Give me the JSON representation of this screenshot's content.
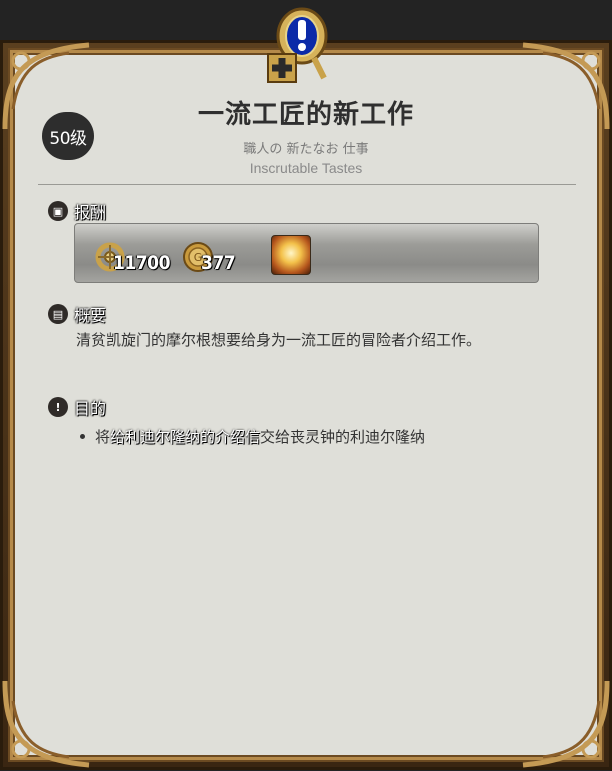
{
  "quest": {
    "level": "50级",
    "title": "一流工匠的新工作",
    "subtitle_jp": "職人の 新たなお 仕事",
    "subtitle_en": "Inscrutable Tastes"
  },
  "sections": {
    "reward_label": "报酬",
    "summary_label": "概要",
    "objective_label": "目的"
  },
  "rewards": {
    "exp": "11700",
    "gil": "377"
  },
  "summary_text": "清贫凯旋门的摩尔根想要给身为一流工匠的冒险者介绍工作。",
  "objective": {
    "prefix": "将",
    "highlight": "给利迪尔隆纳的介绍信",
    "suffix": "交给丧灵钟的利迪尔隆纳"
  },
  "colors": {
    "frame_gold": "#b58a4a",
    "parchment": "#dfdfd9",
    "dark_bg": "#232323"
  }
}
